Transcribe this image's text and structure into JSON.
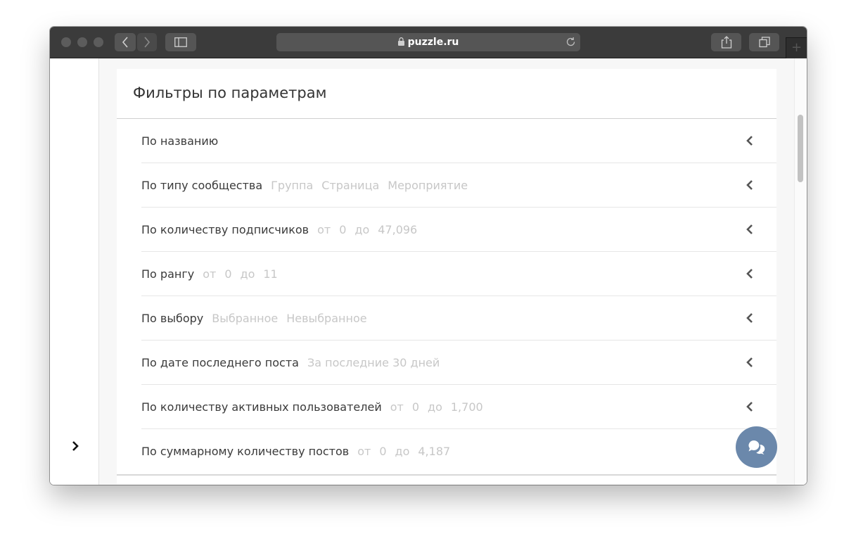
{
  "browser": {
    "url": "puzzle.ru",
    "icons": [
      "back-icon",
      "forward-icon",
      "sidebar-icon",
      "lock-icon",
      "reload-icon",
      "share-icon",
      "tabs-icon",
      "plus-icon"
    ],
    "new_tab_label": "+"
  },
  "panel": {
    "title": "Фильтры по параметрам"
  },
  "filters": [
    {
      "label": "По названию",
      "chips": []
    },
    {
      "label": "По типу сообщества",
      "chips": [
        "Группа",
        "Страница",
        "Мероприятие"
      ]
    },
    {
      "label": "По количеству подписчиков",
      "chips": [
        "от",
        "0",
        "до",
        "47,096"
      ]
    },
    {
      "label": "По рангу",
      "chips": [
        "от",
        "0",
        "до",
        "11"
      ]
    },
    {
      "label": "По выбору",
      "chips": [
        "Выбранное",
        "Невыбранное"
      ]
    },
    {
      "label": "По дате последнего поста",
      "chips": [
        "За последние 30 дней"
      ]
    },
    {
      "label": "По количеству активных пользователей",
      "chips": [
        "от",
        "0",
        "до",
        "1,700"
      ]
    },
    {
      "label": "По суммарному количеству постов",
      "chips": [
        "от",
        "0",
        "до",
        "4,187"
      ]
    }
  ],
  "colors": {
    "toolbar": "#3b3b3b",
    "chat_button": "#6b88ab",
    "chip_text": "#c7c7c7",
    "label_text": "#3a3a3a"
  }
}
